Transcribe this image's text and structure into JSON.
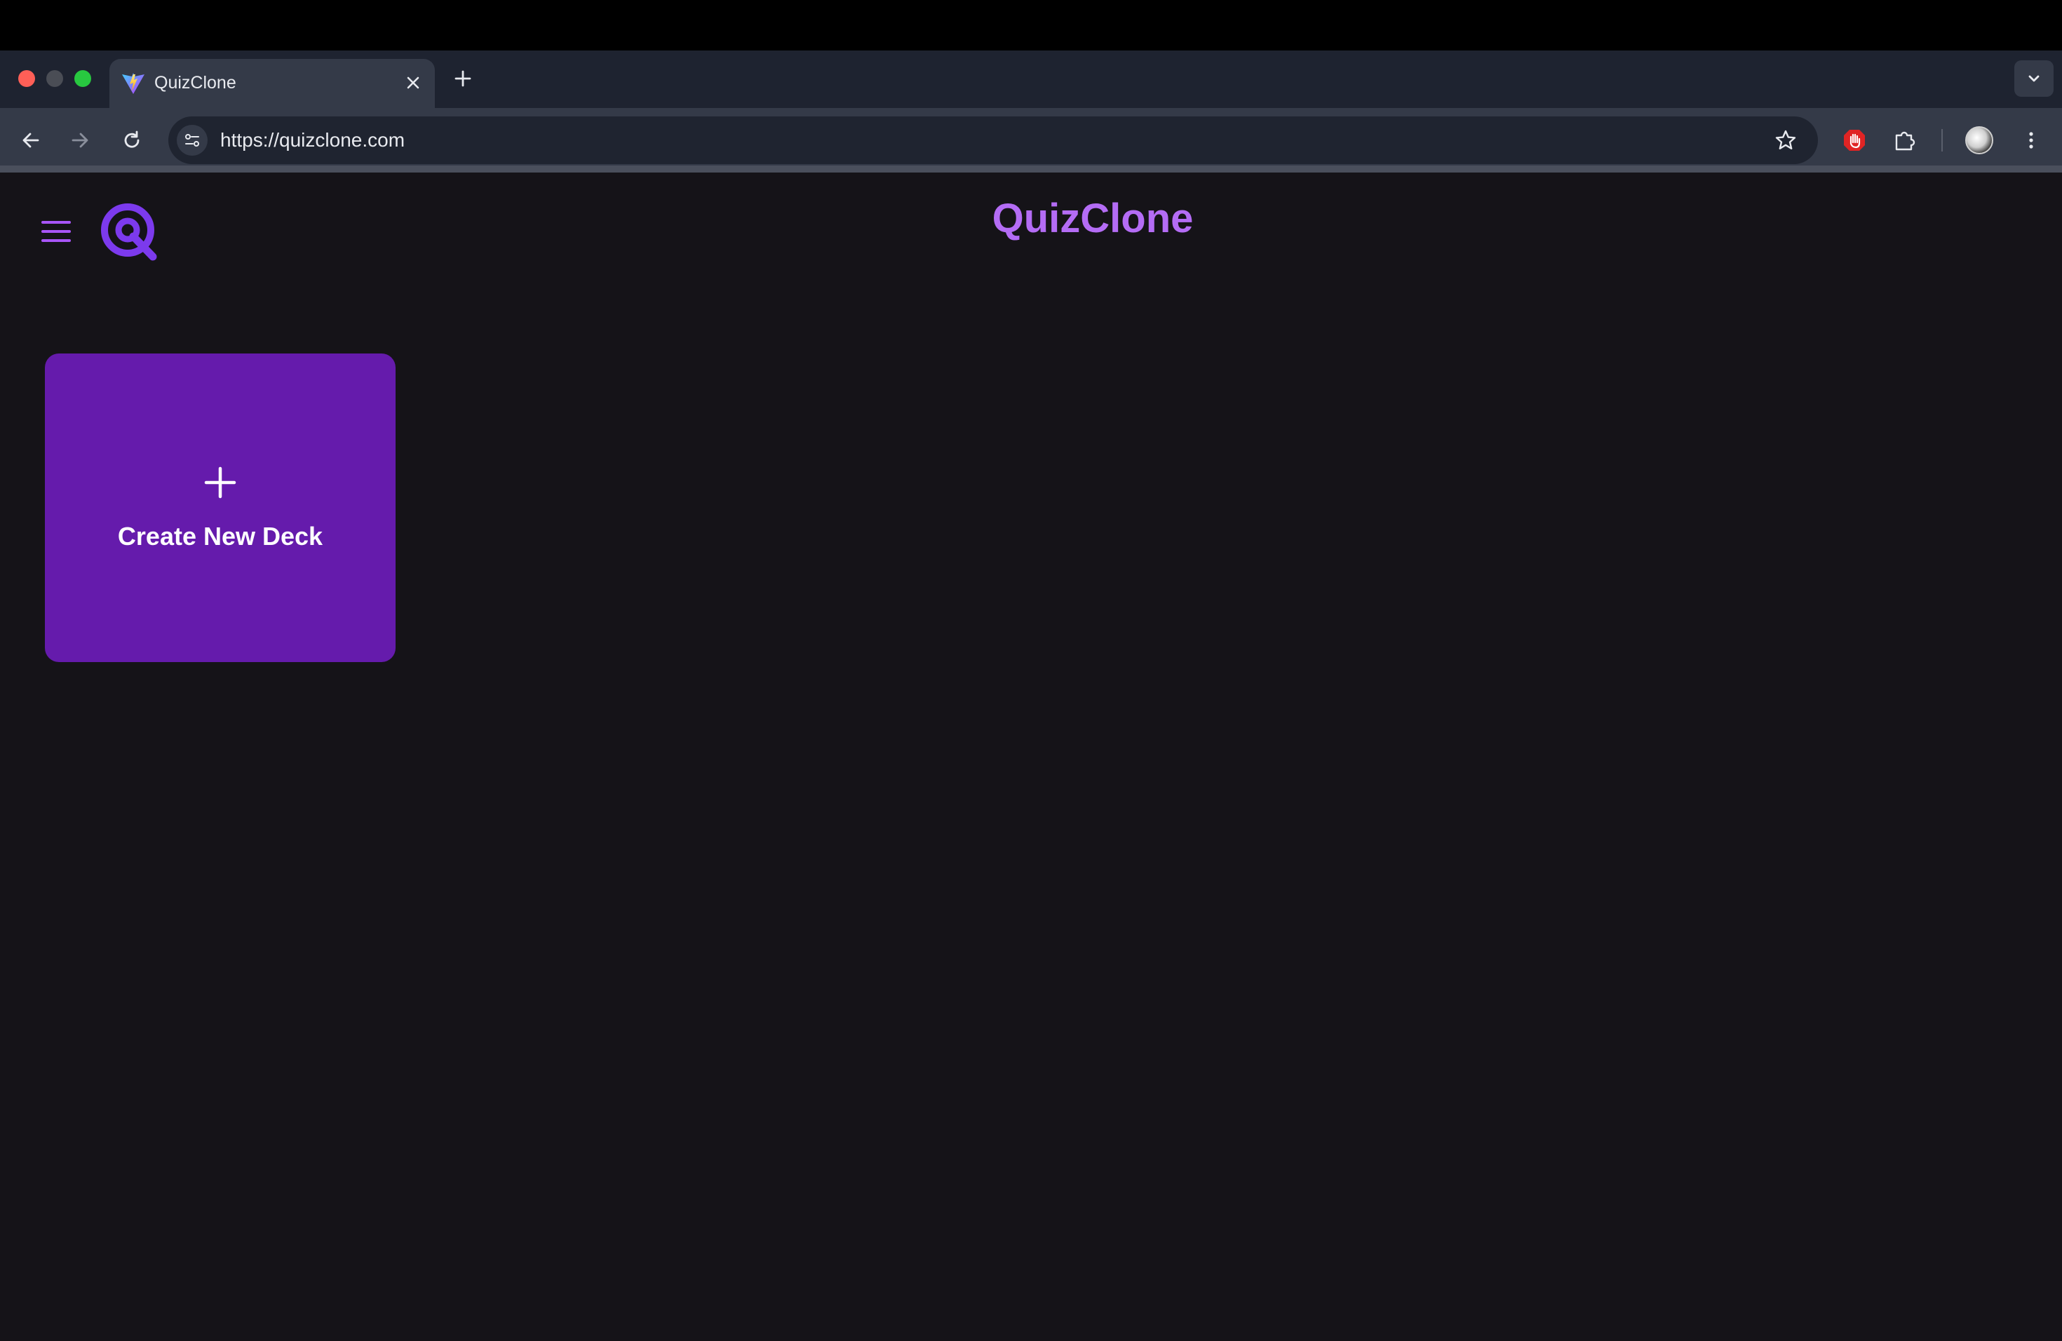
{
  "browser": {
    "tab": {
      "title": "QuizClone"
    },
    "url": "https://quizclone.com",
    "icons": {
      "favicon": "vite-logo-icon",
      "close": "close-icon",
      "new_tab": "plus-icon",
      "tab_search": "chevron-down-icon",
      "back": "arrow-left-icon",
      "forward": "arrow-right-icon",
      "reload": "reload-icon",
      "site_info": "tune-icon",
      "bookmark": "star-icon",
      "extension_adblock": "hand-stop-icon",
      "extensions": "puzzle-icon",
      "more": "kebab-menu-icon"
    }
  },
  "app": {
    "title": "QuizClone",
    "menu_icon": "hamburger-menu-icon",
    "logo_icon": "quizclone-logo-icon",
    "create_card": {
      "icon": "plus-icon",
      "label": "Create New Deck"
    }
  },
  "colors": {
    "page_bg": "#151318",
    "accent": "#b46cf5",
    "card_bg": "#651bac",
    "logo": "#7c3aed"
  }
}
